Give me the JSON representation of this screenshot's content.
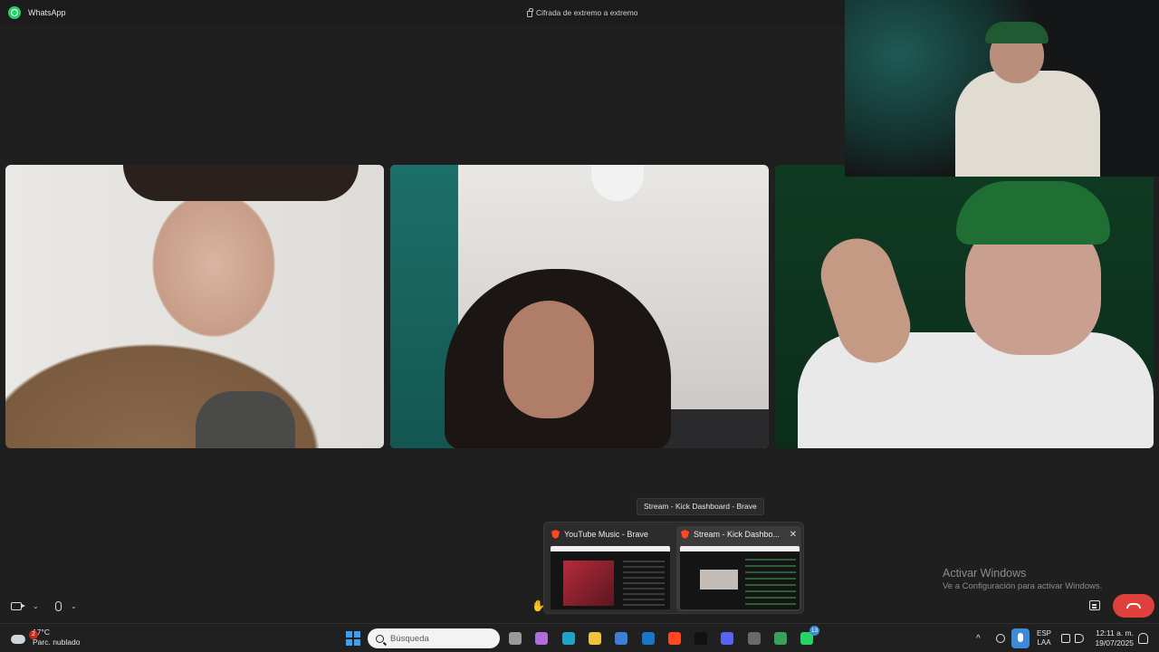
{
  "window": {
    "app_name": "WhatsApp",
    "encryption_text": "Cifrada de extremo a extremo"
  },
  "call": {
    "participants": [
      {
        "id": "participant-1"
      },
      {
        "id": "participant-2"
      },
      {
        "id": "participant-3"
      }
    ],
    "controls": {
      "camera_chevron": "⌄",
      "mic_chevron": "⌄"
    }
  },
  "taskbar_preview": {
    "tooltip": "Stream - Kick Dashboard - Brave",
    "windows": [
      {
        "title": "YouTube Music - Brave"
      },
      {
        "title": "Stream - Kick Dashbo..."
      }
    ],
    "close_glyph": "✕"
  },
  "activation": {
    "title": "Activar Windows",
    "subtitle": "Ve a Configuración para activar Windows."
  },
  "taskbar": {
    "weather": {
      "temp": "17°C",
      "condition": "Parc. nublado",
      "badge": "2"
    },
    "search_placeholder": "Búsqueda",
    "apps": [
      {
        "name": "task-view",
        "color": "#9a9a9a"
      },
      {
        "name": "copilot",
        "color": "#b06bdc"
      },
      {
        "name": "edge",
        "color": "#1fa3c9"
      },
      {
        "name": "file-explorer",
        "color": "#f0c33c"
      },
      {
        "name": "microsoft-store",
        "color": "#3b7fd6"
      },
      {
        "name": "outlook",
        "color": "#1877c9"
      },
      {
        "name": "brave",
        "color": "#ff4724"
      },
      {
        "name": "tiktok",
        "color": "#111111"
      },
      {
        "name": "discord",
        "color": "#5865f2"
      },
      {
        "name": "obs",
        "color": "#6a6a6a"
      },
      {
        "name": "chrome",
        "color": "#3aa15a"
      },
      {
        "name": "whatsapp",
        "color": "#25d366",
        "badge": "13"
      }
    ],
    "tray": {
      "caret": "^",
      "lang_line1": "ESP",
      "lang_line2": "LAA",
      "time": "12:11 a. m.",
      "date": "19/07/2025"
    }
  }
}
